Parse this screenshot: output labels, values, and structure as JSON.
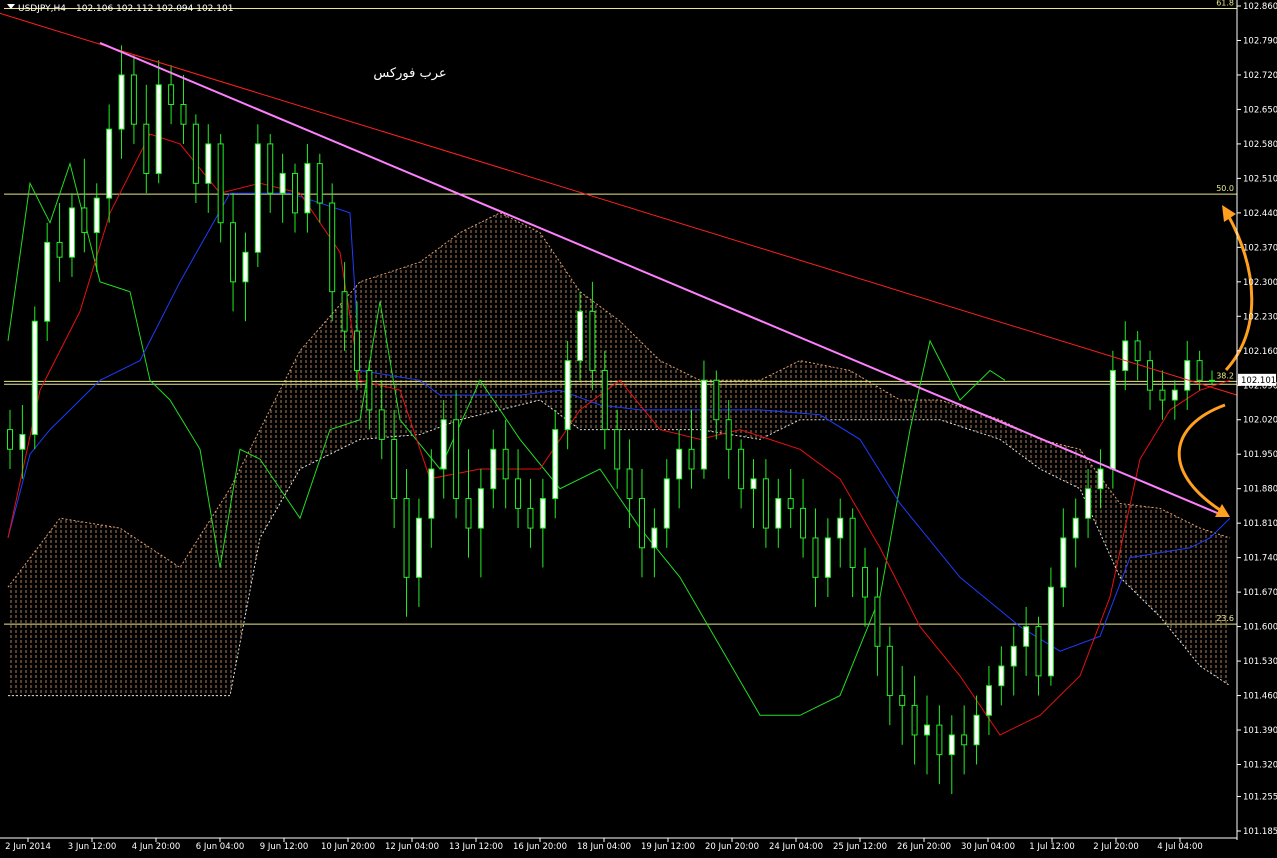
{
  "header": {
    "symbol": "USDJPY,H4",
    "ohlc": "102.106 102.112 102.094 102.101"
  },
  "annotation": "عرب فوركس",
  "chart_data": {
    "type": "candlestick",
    "symbol": "USDJPY",
    "timeframe": "H4",
    "ylim": [
      101.185,
      102.86
    ],
    "y_ticks": [
      102.86,
      102.79,
      102.72,
      102.65,
      102.58,
      102.51,
      102.44,
      102.37,
      102.3,
      102.23,
      102.16,
      102.09,
      102.02,
      101.95,
      101.88,
      101.81,
      101.74,
      101.67,
      101.6,
      101.53,
      101.46,
      101.39,
      101.32,
      101.255,
      101.185
    ],
    "x_labels": [
      "2 Jun 2014",
      "3 Jun 12:00",
      "4 Jun 20:00",
      "6 Jun 04:00",
      "9 Jun 12:00",
      "10 Jun 20:00",
      "12 Jun 04:00",
      "13 Jun 12:00",
      "16 Jun 20:00",
      "18 Jun 04:00",
      "19 Jun 12:00",
      "20 Jun 20:00",
      "24 Jun 04:00",
      "25 Jun 12:00",
      "26 Jun 20:00",
      "30 Jun 04:00",
      "1 Jul 12:00",
      "2 Jul 20:00",
      "4 Jul 04:00"
    ],
    "current_price": "102.101",
    "fibonacci": [
      {
        "label": "61.8",
        "value": 102.855
      },
      {
        "label": "50.0",
        "value": 102.478
      },
      {
        "label": "38.2",
        "value": 102.098
      },
      {
        "label": "23.6",
        "value": 101.605
      }
    ],
    "fib_line_2": 102.092,
    "trendlines": [
      {
        "color": "#ff2020",
        "from": [
          0,
          102.845
        ],
        "to": [
          1237,
          102.07
        ]
      },
      {
        "color": "#ff80ff",
        "from": [
          100,
          102.785
        ],
        "to": [
          1218,
          101.83
        ]
      }
    ],
    "candles": [
      [
        102.0,
        102.04,
        101.92,
        101.96
      ],
      [
        101.96,
        102.05,
        101.9,
        101.99
      ],
      [
        101.99,
        102.25,
        101.96,
        102.22
      ],
      [
        102.22,
        102.42,
        102.18,
        102.38
      ],
      [
        102.38,
        102.46,
        102.3,
        102.35
      ],
      [
        102.35,
        102.48,
        102.31,
        102.45
      ],
      [
        102.45,
        102.55,
        102.36,
        102.4
      ],
      [
        102.4,
        102.5,
        102.32,
        102.47
      ],
      [
        102.47,
        102.66,
        102.42,
        102.61
      ],
      [
        102.61,
        102.78,
        102.55,
        102.72
      ],
      [
        102.72,
        102.76,
        102.58,
        102.62
      ],
      [
        102.62,
        102.7,
        102.48,
        102.52
      ],
      [
        102.52,
        102.75,
        102.5,
        102.7
      ],
      [
        102.7,
        102.74,
        102.62,
        102.66
      ],
      [
        102.66,
        102.72,
        102.58,
        102.62
      ],
      [
        102.62,
        102.64,
        102.46,
        102.5
      ],
      [
        102.5,
        102.62,
        102.44,
        102.58
      ],
      [
        102.58,
        102.6,
        102.38,
        102.42
      ],
      [
        102.42,
        102.48,
        102.24,
        102.3
      ],
      [
        102.3,
        102.4,
        102.22,
        102.36
      ],
      [
        102.36,
        102.62,
        102.33,
        102.58
      ],
      [
        102.58,
        102.6,
        102.44,
        102.48
      ],
      [
        102.48,
        102.56,
        102.42,
        102.52
      ],
      [
        102.52,
        102.54,
        102.4,
        102.44
      ],
      [
        102.44,
        102.58,
        102.4,
        102.54
      ],
      [
        102.54,
        102.56,
        102.42,
        102.46
      ],
      [
        102.46,
        102.5,
        102.22,
        102.28
      ],
      [
        102.28,
        102.34,
        102.16,
        102.2
      ],
      [
        102.2,
        102.26,
        102.08,
        102.12
      ],
      [
        102.12,
        102.14,
        102.0,
        102.04
      ],
      [
        102.04,
        102.1,
        101.94,
        101.98
      ],
      [
        101.98,
        102.04,
        101.8,
        101.86
      ],
      [
        101.86,
        101.92,
        101.62,
        101.7
      ],
      [
        101.7,
        101.86,
        101.64,
        101.82
      ],
      [
        101.82,
        101.96,
        101.76,
        101.92
      ],
      [
        101.92,
        102.06,
        101.86,
        102.02
      ],
      [
        102.02,
        102.08,
        101.82,
        101.86
      ],
      [
        101.86,
        101.96,
        101.74,
        101.8
      ],
      [
        101.8,
        101.92,
        101.7,
        101.88
      ],
      [
        101.88,
        102.0,
        101.84,
        101.96
      ],
      [
        101.96,
        102.02,
        101.84,
        101.9
      ],
      [
        101.9,
        101.96,
        101.8,
        101.84
      ],
      [
        101.84,
        101.9,
        101.76,
        101.8
      ],
      [
        101.8,
        101.9,
        101.72,
        101.86
      ],
      [
        101.86,
        102.04,
        101.82,
        102.0
      ],
      [
        102.0,
        102.18,
        101.96,
        102.14
      ],
      [
        102.14,
        102.28,
        102.1,
        102.24
      ],
      [
        102.24,
        102.3,
        102.08,
        102.12
      ],
      [
        102.12,
        102.16,
        101.96,
        102.0
      ],
      [
        102.0,
        102.04,
        101.88,
        101.92
      ],
      [
        101.92,
        101.98,
        101.8,
        101.86
      ],
      [
        101.86,
        101.92,
        101.7,
        101.76
      ],
      [
        101.76,
        101.84,
        101.7,
        101.8
      ],
      [
        101.8,
        101.94,
        101.76,
        101.9
      ],
      [
        101.9,
        102.0,
        101.84,
        101.96
      ],
      [
        101.96,
        102.04,
        101.88,
        101.92
      ],
      [
        101.92,
        102.14,
        101.9,
        102.1
      ],
      [
        102.1,
        102.12,
        101.98,
        102.02
      ],
      [
        102.02,
        102.06,
        101.9,
        101.96
      ],
      [
        101.96,
        101.98,
        101.84,
        101.88
      ],
      [
        101.88,
        101.94,
        101.8,
        101.9
      ],
      [
        101.9,
        101.94,
        101.76,
        101.8
      ],
      [
        101.8,
        101.9,
        101.76,
        101.86
      ],
      [
        101.86,
        101.92,
        101.8,
        101.84
      ],
      [
        101.84,
        101.9,
        101.74,
        101.78
      ],
      [
        101.78,
        101.84,
        101.64,
        101.7
      ],
      [
        101.7,
        101.82,
        101.66,
        101.78
      ],
      [
        101.78,
        101.86,
        101.72,
        101.82
      ],
      [
        101.82,
        101.84,
        101.66,
        101.72
      ],
      [
        101.72,
        101.76,
        101.6,
        101.66
      ],
      [
        101.66,
        101.72,
        101.5,
        101.56
      ],
      [
        101.56,
        101.6,
        101.4,
        101.46
      ],
      [
        101.46,
        101.52,
        101.36,
        101.44
      ],
      [
        101.44,
        101.5,
        101.32,
        101.38
      ],
      [
        101.38,
        101.46,
        101.3,
        101.4
      ],
      [
        101.4,
        101.44,
        101.28,
        101.34
      ],
      [
        101.34,
        101.42,
        101.26,
        101.38
      ],
      [
        101.38,
        101.44,
        101.3,
        101.36
      ],
      [
        101.36,
        101.46,
        101.32,
        101.42
      ],
      [
        101.42,
        101.52,
        101.38,
        101.48
      ],
      [
        101.48,
        101.56,
        101.44,
        101.52
      ],
      [
        101.52,
        101.6,
        101.46,
        101.56
      ],
      [
        101.56,
        101.64,
        101.5,
        101.6
      ],
      [
        101.6,
        101.62,
        101.46,
        101.5
      ],
      [
        101.5,
        101.72,
        101.48,
        101.68
      ],
      [
        101.68,
        101.84,
        101.64,
        101.78
      ],
      [
        101.78,
        101.86,
        101.72,
        101.82
      ],
      [
        101.82,
        101.92,
        101.78,
        101.88
      ],
      [
        101.88,
        101.96,
        101.84,
        101.92
      ],
      [
        101.92,
        102.16,
        101.88,
        102.12
      ],
      [
        102.12,
        102.22,
        102.08,
        102.18
      ],
      [
        102.18,
        102.2,
        102.1,
        102.14
      ],
      [
        102.14,
        102.16,
        102.04,
        102.08
      ],
      [
        102.08,
        102.12,
        102.02,
        102.06
      ],
      [
        102.06,
        102.1,
        102.02,
        102.08
      ],
      [
        102.08,
        102.18,
        102.04,
        102.14
      ],
      [
        102.14,
        102.16,
        102.08,
        102.1
      ],
      [
        102.1,
        102.12,
        102.09,
        102.1
      ]
    ],
    "kijun": [
      [
        8,
        101.78
      ],
      [
        30,
        101.95
      ],
      [
        50,
        102.0
      ],
      [
        100,
        102.1
      ],
      [
        140,
        102.14
      ],
      [
        180,
        102.3
      ],
      [
        230,
        102.48
      ],
      [
        290,
        102.48
      ],
      [
        350,
        102.44
      ],
      [
        360,
        102.12
      ],
      [
        420,
        102.1
      ],
      [
        440,
        102.07
      ],
      [
        520,
        102.07
      ],
      [
        560,
        102.08
      ],
      [
        600,
        102.05
      ],
      [
        640,
        102.04
      ],
      [
        700,
        102.04
      ],
      [
        760,
        102.04
      ],
      [
        820,
        102.03
      ],
      [
        860,
        101.98
      ],
      [
        900,
        101.85
      ],
      [
        960,
        101.7
      ],
      [
        1020,
        101.6
      ],
      [
        1060,
        101.55
      ],
      [
        1100,
        101.58
      ],
      [
        1130,
        101.74
      ],
      [
        1190,
        101.76
      ],
      [
        1210,
        101.78
      ],
      [
        1230,
        101.82
      ]
    ],
    "tenkan": [
      [
        8,
        101.78
      ],
      [
        40,
        102.08
      ],
      [
        80,
        102.24
      ],
      [
        110,
        102.44
      ],
      [
        150,
        102.6
      ],
      [
        180,
        102.58
      ],
      [
        220,
        102.48
      ],
      [
        260,
        102.5
      ],
      [
        300,
        102.48
      ],
      [
        340,
        102.36
      ],
      [
        360,
        102.1
      ],
      [
        400,
        102.08
      ],
      [
        430,
        101.9
      ],
      [
        480,
        101.92
      ],
      [
        540,
        101.92
      ],
      [
        580,
        102.04
      ],
      [
        620,
        102.1
      ],
      [
        660,
        102.0
      ],
      [
        700,
        101.98
      ],
      [
        740,
        102.0
      ],
      [
        800,
        101.96
      ],
      [
        840,
        101.9
      ],
      [
        880,
        101.76
      ],
      [
        920,
        101.6
      ],
      [
        960,
        101.5
      ],
      [
        1000,
        101.38
      ],
      [
        1040,
        101.42
      ],
      [
        1080,
        101.5
      ],
      [
        1110,
        101.66
      ],
      [
        1140,
        101.94
      ],
      [
        1170,
        102.04
      ],
      [
        1200,
        102.08
      ],
      [
        1230,
        102.1
      ]
    ],
    "chikou": [
      [
        8,
        102.18
      ],
      [
        30,
        102.5
      ],
      [
        50,
        102.42
      ],
      [
        70,
        102.54
      ],
      [
        100,
        102.3
      ],
      [
        130,
        102.28
      ],
      [
        150,
        102.1
      ],
      [
        170,
        102.06
      ],
      [
        200,
        101.96
      ],
      [
        220,
        101.72
      ],
      [
        240,
        101.96
      ],
      [
        260,
        101.94
      ],
      [
        300,
        101.82
      ],
      [
        330,
        102.0
      ],
      [
        360,
        102.02
      ],
      [
        380,
        102.26
      ],
      [
        400,
        102.02
      ],
      [
        440,
        101.92
      ],
      [
        480,
        102.1
      ],
      [
        520,
        101.98
      ],
      [
        560,
        101.88
      ],
      [
        600,
        101.92
      ],
      [
        640,
        101.8
      ],
      [
        680,
        101.7
      ],
      [
        720,
        101.56
      ],
      [
        760,
        101.42
      ],
      [
        800,
        101.42
      ],
      [
        840,
        101.46
      ],
      [
        880,
        101.66
      ],
      [
        910,
        102.0
      ],
      [
        930,
        102.18
      ],
      [
        960,
        102.06
      ],
      [
        990,
        102.12
      ],
      [
        1005,
        102.1
      ]
    ],
    "cloud": {
      "span_a": [
        [
          8,
          101.68
        ],
        [
          60,
          101.82
        ],
        [
          120,
          101.8
        ],
        [
          180,
          101.72
        ],
        [
          230,
          101.88
        ],
        [
          260,
          102.0
        ],
        [
          300,
          102.16
        ],
        [
          360,
          102.3
        ],
        [
          420,
          102.34
        ],
        [
          460,
          102.4
        ],
        [
          500,
          102.44
        ],
        [
          540,
          102.4
        ],
        [
          580,
          102.28
        ],
        [
          620,
          102.22
        ],
        [
          660,
          102.14
        ],
        [
          700,
          102.1
        ],
        [
          760,
          102.1
        ],
        [
          800,
          102.14
        ],
        [
          850,
          102.12
        ],
        [
          900,
          102.06
        ],
        [
          940,
          102.06
        ],
        [
          1000,
          102.02
        ],
        [
          1040,
          101.98
        ],
        [
          1080,
          101.96
        ],
        [
          1120,
          101.85
        ],
        [
          1160,
          101.84
        ],
        [
          1200,
          101.8
        ],
        [
          1230,
          101.78
        ]
      ],
      "span_b": [
        [
          8,
          101.46
        ],
        [
          60,
          101.46
        ],
        [
          120,
          101.46
        ],
        [
          180,
          101.46
        ],
        [
          230,
          101.46
        ],
        [
          260,
          101.78
        ],
        [
          300,
          101.92
        ],
        [
          360,
          101.98
        ],
        [
          420,
          101.99
        ],
        [
          460,
          102.02
        ],
        [
          500,
          102.04
        ],
        [
          540,
          102.06
        ],
        [
          580,
          102.0
        ],
        [
          620,
          102.0
        ],
        [
          660,
          102.0
        ],
        [
          700,
          102.0
        ],
        [
          760,
          101.98
        ],
        [
          800,
          102.02
        ],
        [
          850,
          102.02
        ],
        [
          900,
          102.02
        ],
        [
          940,
          102.02
        ],
        [
          1000,
          101.98
        ],
        [
          1040,
          101.92
        ],
        [
          1080,
          101.88
        ],
        [
          1120,
          101.7
        ],
        [
          1160,
          101.62
        ],
        [
          1200,
          101.52
        ],
        [
          1230,
          101.48
        ]
      ]
    }
  }
}
